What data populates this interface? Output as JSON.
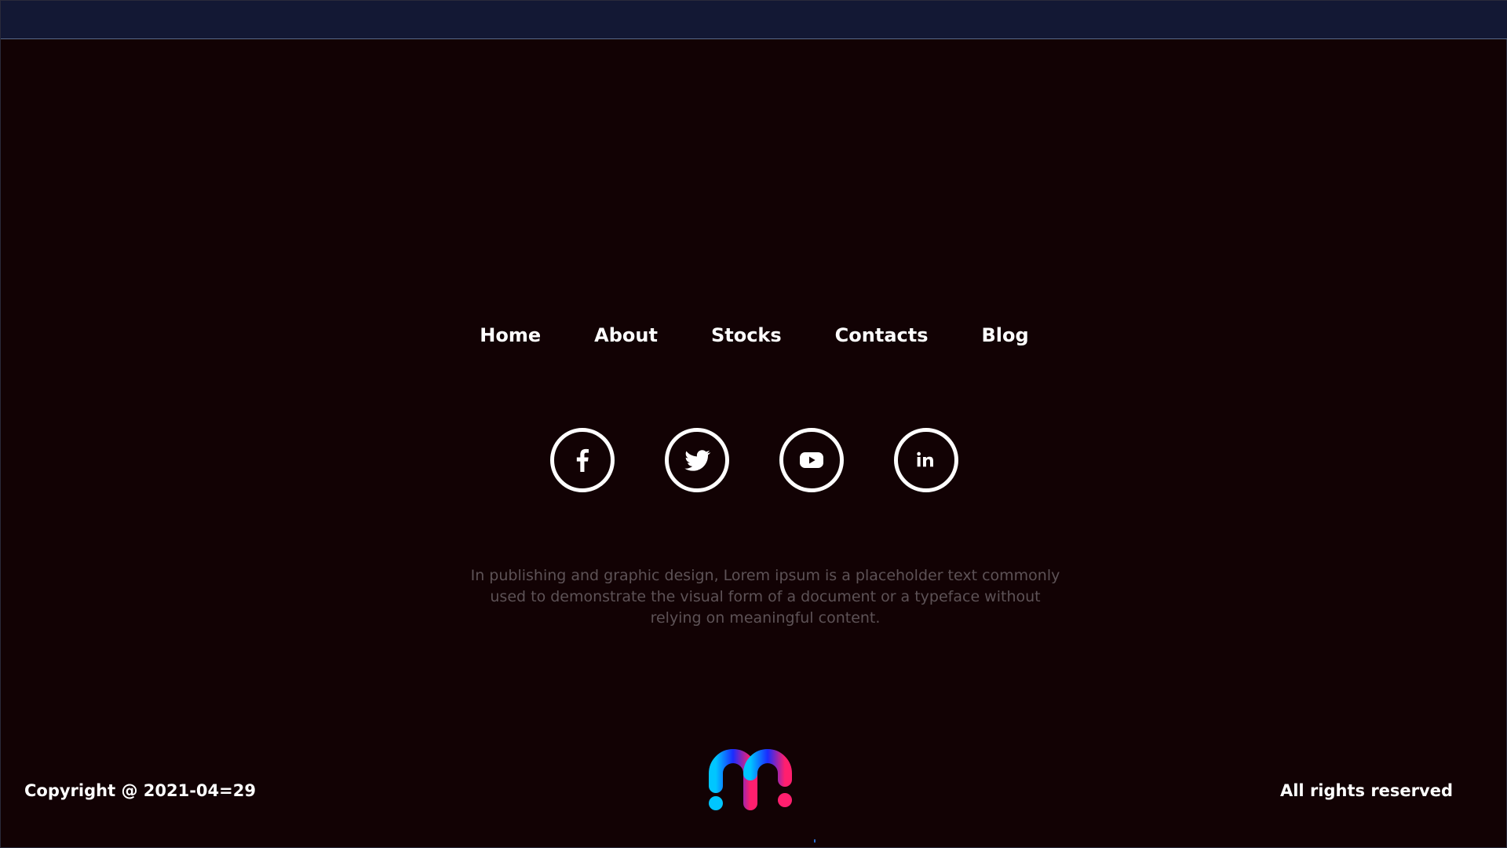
{
  "nav": {
    "items": [
      {
        "label": "Home"
      },
      {
        "label": "About"
      },
      {
        "label": "Stocks"
      },
      {
        "label": "Contacts"
      },
      {
        "label": "Blog"
      }
    ]
  },
  "socials": [
    {
      "icon": "facebook-icon"
    },
    {
      "icon": "twitter-icon"
    },
    {
      "icon": "youtube-icon"
    },
    {
      "icon": "linkedin-icon"
    }
  ],
  "description": "In publishing and graphic design, Lorem ipsum is a placeholder text commonly used to demonstrate the visual form of a document or a typeface without relying on meaningful content.",
  "footer": {
    "copyright": "Copyright @ 2021-04=29",
    "rights": "All rights reserved"
  },
  "colors": {
    "background": "#120204",
    "topbar": "#131834",
    "text": "#ffffff",
    "muted": "#5d5256",
    "logo_start": "#00c6ff",
    "logo_mid": "#1a2cff",
    "logo_end": "#ff1f6e"
  }
}
